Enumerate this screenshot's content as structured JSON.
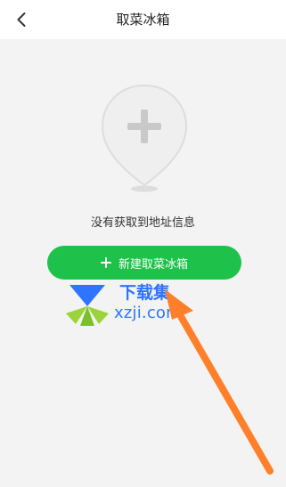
{
  "header": {
    "title": "取菜冰箱"
  },
  "main": {
    "empty_message": "没有获取到地址信息",
    "create_button_label": "新建取菜冰箱"
  },
  "watermark": {
    "top_text": "下载集",
    "bottom_text": "xzji.com"
  },
  "icons": {
    "back": "chevron-left-icon",
    "location_add": "location-pin-add-icon",
    "button_plus": "plus-icon",
    "arrow": "annotation-arrow"
  },
  "colors": {
    "background": "#f3f3f3",
    "topbar": "#ffffff",
    "button": "#1ec24a",
    "watermark": "#2f74ff",
    "arrow": "#ff7f2a"
  }
}
